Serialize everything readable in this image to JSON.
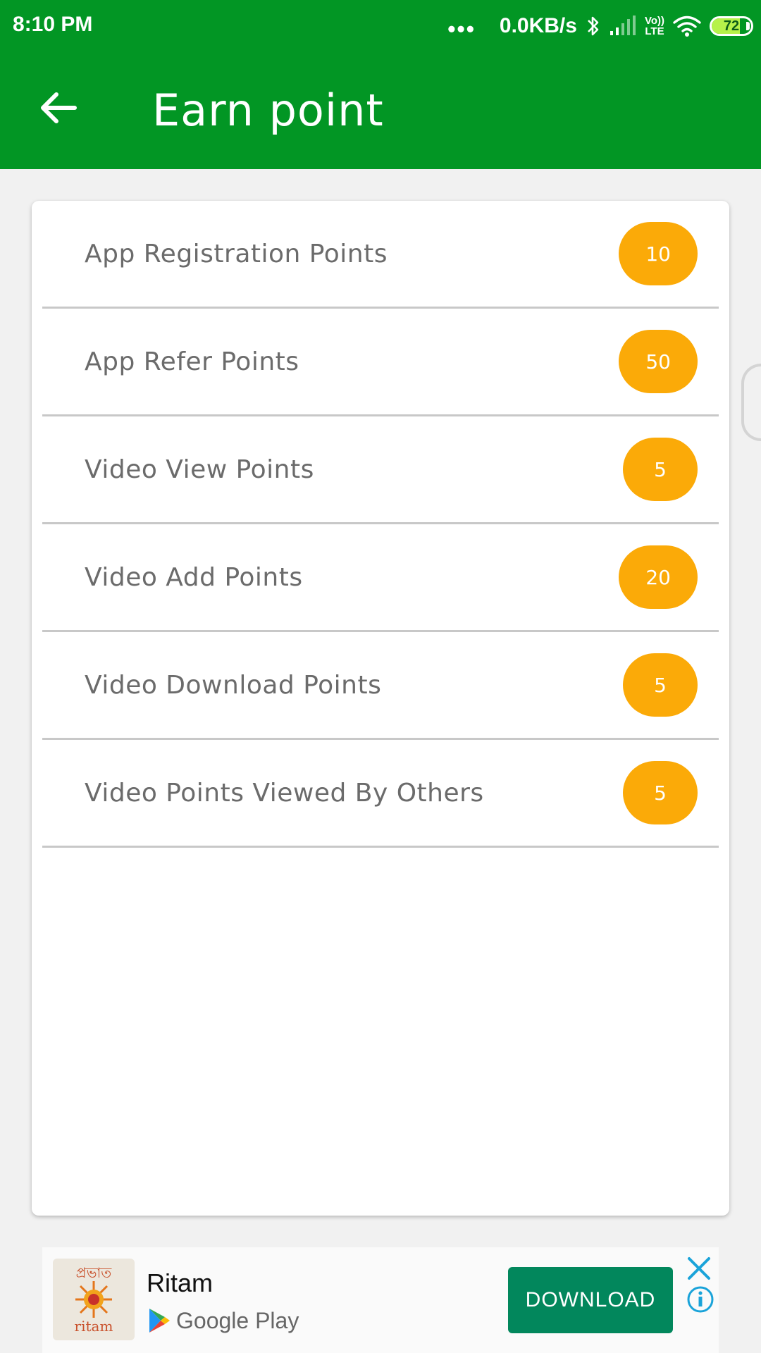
{
  "status_bar": {
    "time": "8:10 PM",
    "dots": "•••",
    "speed": "0.0KB/s",
    "network_label_top": "Vo))",
    "network_label_bottom": "LTE",
    "battery_level": "72",
    "battery_fraction": 0.72,
    "icons": [
      "bluetooth-icon",
      "signal-icon",
      "volte-icon",
      "wifi-icon",
      "battery-icon"
    ]
  },
  "toolbar": {
    "title": "Earn point",
    "back_icon": "arrow-left-icon"
  },
  "points_list": [
    {
      "label": "App Registration Points",
      "points": "10"
    },
    {
      "label": "App Refer Points",
      "points": "50"
    },
    {
      "label": "Video View Points",
      "points": "5"
    },
    {
      "label": "Video Add Points",
      "points": "20"
    },
    {
      "label": "Video Download Points",
      "points": "5"
    },
    {
      "label": "Video Points Viewed By Others",
      "points": "5"
    }
  ],
  "ad": {
    "app_name": "Ritam",
    "store_name": "Google Play",
    "download_label": "DOWNLOAD",
    "thumb_text_top": "প্রভাত",
    "thumb_text_bottom": "ritam"
  },
  "colors": {
    "appbar": "#029624",
    "badge": "#fbaa08",
    "download_button": "#02875c",
    "label_text": "#6b6b6b"
  }
}
